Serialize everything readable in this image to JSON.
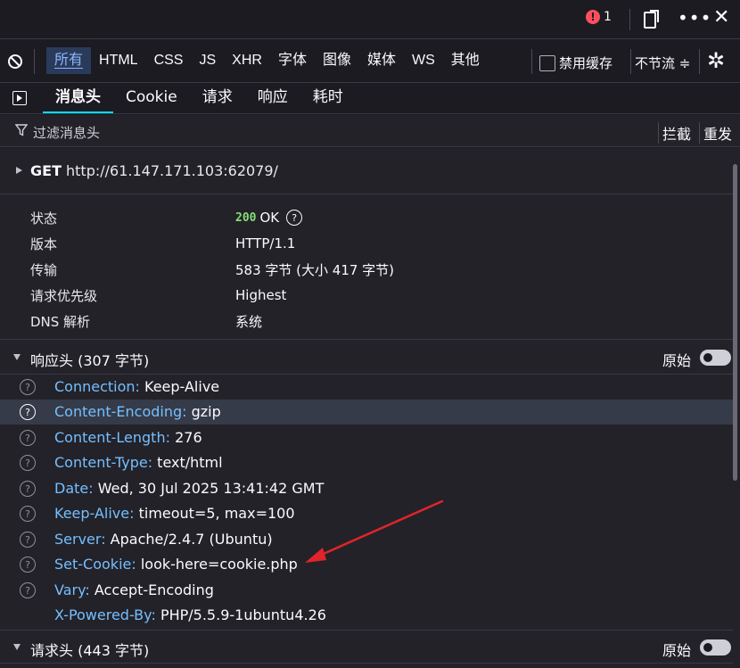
{
  "topbar": {
    "error_count": "1",
    "more_glyph": "•••",
    "close_glyph": "✕",
    "error_icon": "error-icon",
    "dock_icon": "dock-icon"
  },
  "filterbar": {
    "tabs": [
      "所有",
      "HTML",
      "CSS",
      "JS",
      "XHR",
      "字体",
      "图像",
      "媒体",
      "WS",
      "其他"
    ],
    "active_tab": "所有",
    "disable_cache_label": "禁用缓存",
    "throttle_label": "不节流 ≑"
  },
  "detail": {
    "tabs": [
      "消息头",
      "Cookie",
      "请求",
      "响应",
      "耗时"
    ],
    "active_tab": "消息头"
  },
  "filter_row": {
    "placeholder": "过滤消息头",
    "block_label": "拦截",
    "resend_label": "重发"
  },
  "request": {
    "method": "GET",
    "url": "http://61.147.171.103:62079/"
  },
  "summary": {
    "rows": [
      {
        "label": "状态",
        "value": "OK",
        "code": "200"
      },
      {
        "label": "版本",
        "value": "HTTP/1.1"
      },
      {
        "label": "传输",
        "value": "583 字节 (大小 417 字节)"
      },
      {
        "label": "请求优先级",
        "value": "Highest"
      },
      {
        "label": "DNS 解析",
        "value": "系统"
      }
    ]
  },
  "response_headers": {
    "title": "响应头 (307 字节)",
    "raw_label": "原始",
    "items": [
      {
        "name": "Connection:",
        "value": "Keep-Alive"
      },
      {
        "name": "Content-Encoding:",
        "value": "gzip"
      },
      {
        "name": "Content-Length:",
        "value": "276"
      },
      {
        "name": "Content-Type:",
        "value": "text/html"
      },
      {
        "name": "Date:",
        "value": "Wed, 30 Jul 2025 13:41:42 GMT"
      },
      {
        "name": "Keep-Alive:",
        "value": "timeout=5, max=100"
      },
      {
        "name": "Server:",
        "value": "Apache/2.4.7 (Ubuntu)"
      },
      {
        "name": "Set-Cookie:",
        "value": "look-here=cookie.php"
      },
      {
        "name": "Vary:",
        "value": "Accept-Encoding"
      },
      {
        "name": "X-Powered-By:",
        "value": "PHP/5.5.9-1ubuntu4.26"
      }
    ]
  },
  "request_headers": {
    "title": "请求头 (443 字节)",
    "raw_label": "原始"
  },
  "colors": {
    "accent": "#75bfff",
    "annotation_arrow": "#e0242a",
    "status_ok": "#86de74"
  }
}
